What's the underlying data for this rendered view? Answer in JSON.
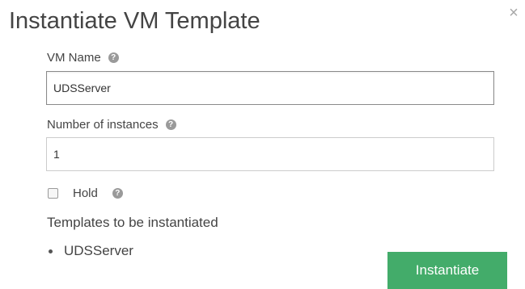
{
  "dialog": {
    "title": "Instantiate VM Template",
    "close_glyph": "×"
  },
  "form": {
    "vm_name": {
      "label": "VM Name",
      "value": "UDSServer",
      "help_icon": "question-circle-icon"
    },
    "instances": {
      "label": "Number of instances",
      "value": "1",
      "help_icon": "question-circle-icon"
    },
    "hold": {
      "label": "Hold",
      "checked": false,
      "help_icon": "question-circle-icon"
    }
  },
  "templates": {
    "title": "Templates to be instantiated",
    "items": [
      "UDSServer"
    ]
  },
  "actions": {
    "instantiate_label": "Instantiate"
  },
  "colors": {
    "primary_button": "#43ac6a",
    "help_icon": "#9a9a9a",
    "close_icon": "#a8a8a8"
  }
}
